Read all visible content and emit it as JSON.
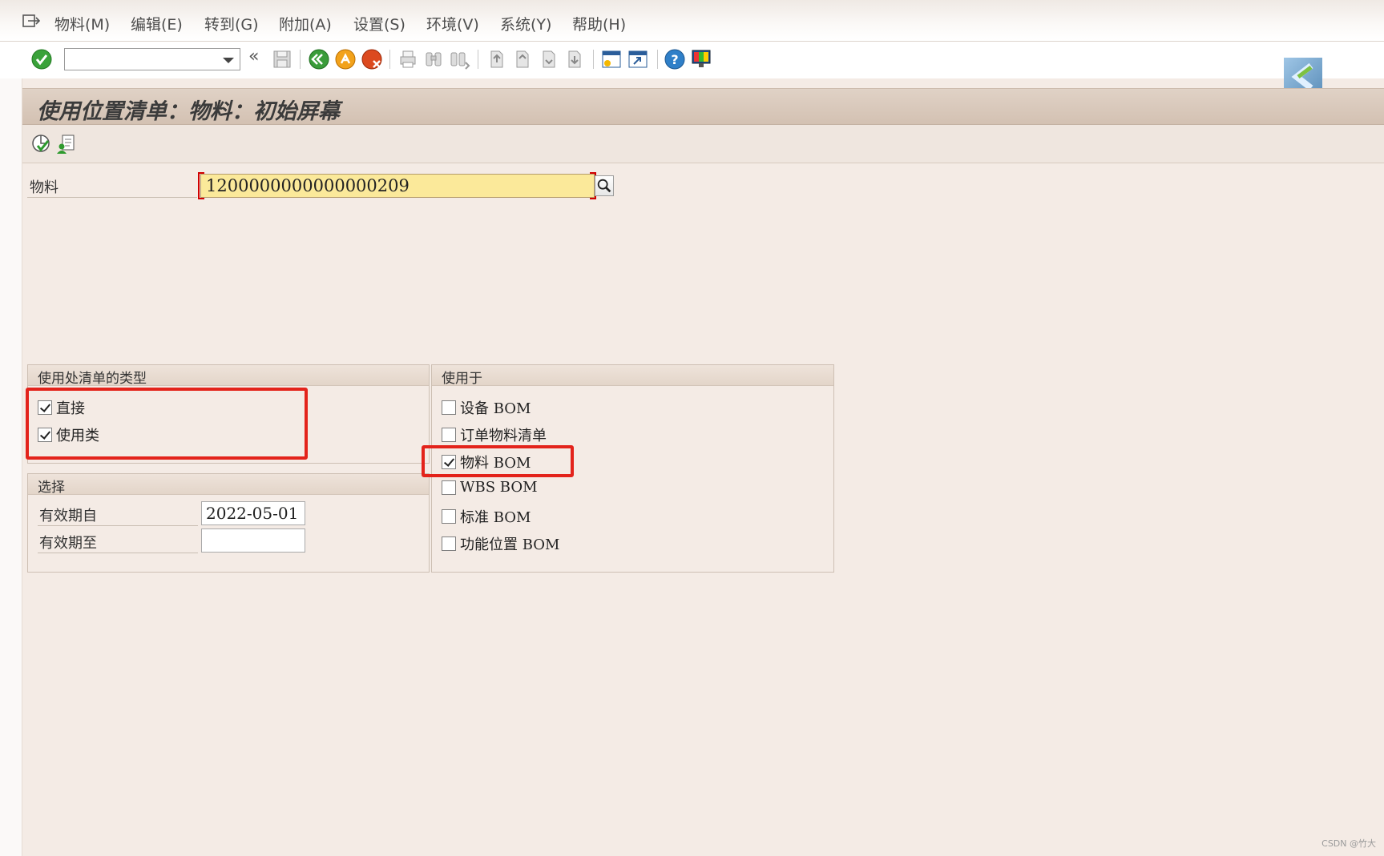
{
  "menu": {
    "items": [
      "物料(M)",
      "编辑(E)",
      "转到(G)",
      "附加(A)",
      "设置(S)",
      "环境(V)",
      "系统(Y)",
      "帮助(H)"
    ]
  },
  "toolbar": {
    "command_field_value": "",
    "back_glyph": "«",
    "icons": [
      "enter-icon",
      "save-icon",
      "back-icon",
      "exit-icon",
      "cancel-icon",
      "print-icon",
      "find-icon",
      "find-next-icon",
      "first-page-icon",
      "prev-page-icon",
      "next-page-icon",
      "last-page-icon",
      "new-session-icon",
      "shortcut-icon",
      "help-icon",
      "layout-icon"
    ]
  },
  "title": "使用位置清单：物料：初始屏幕",
  "material": {
    "label": "物料",
    "value": "1200000000000000209"
  },
  "usage_type": {
    "header": "使用处清单的类型",
    "items": [
      {
        "label": "直接",
        "checked": true
      },
      {
        "label": "使用类",
        "checked": true
      }
    ]
  },
  "selection": {
    "header": "选择",
    "valid_from_label": "有效期自",
    "valid_from_value": "2022-05-01",
    "valid_to_label": "有效期至",
    "valid_to_value": ""
  },
  "used_in": {
    "header": "使用于",
    "items": [
      {
        "label": "设备 BOM",
        "checked": false
      },
      {
        "label": "订单物料清单",
        "checked": false
      },
      {
        "label": "物料 BOM",
        "checked": true
      },
      {
        "label": "WBS BOM",
        "checked": false
      },
      {
        "label": "标准 BOM",
        "checked": false
      },
      {
        "label": "功能位置 BOM",
        "checked": false
      }
    ]
  },
  "colors": {
    "highlight": "#e3231b",
    "required_field": "#fbe99a",
    "title_bar": "#d8c8ba"
  },
  "watermark": "CSDN @竹大"
}
